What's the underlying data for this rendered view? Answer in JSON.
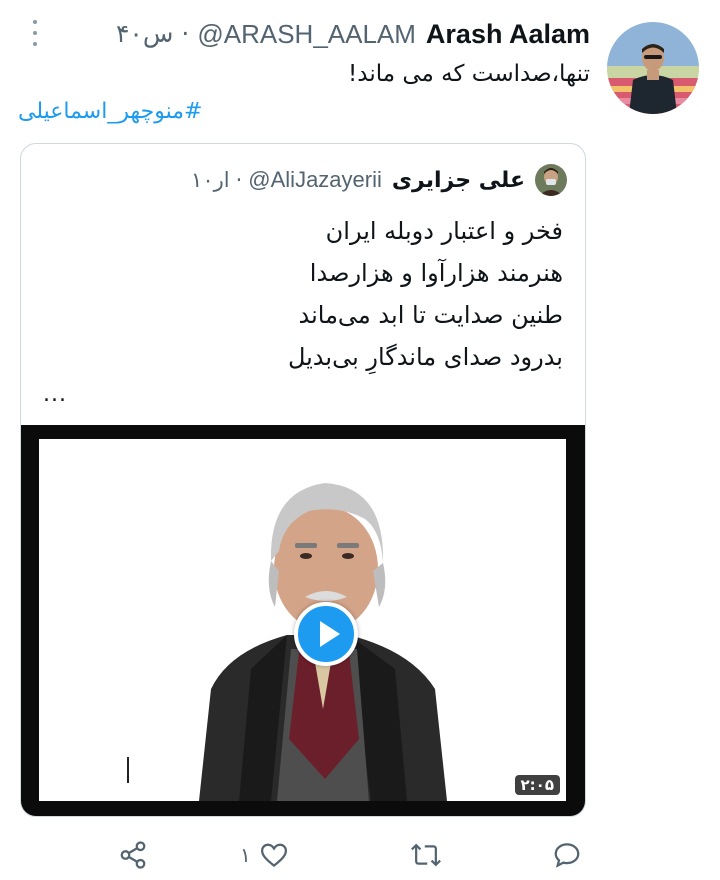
{
  "tweet": {
    "display_name": "Arash Aalam",
    "handle": "@ARASH_AALAM",
    "separator": "·",
    "time": "۴۰س",
    "text": "تنها،صداست که می ماند!",
    "hashtag": "#منوچهر_اسماعیلی"
  },
  "quoted": {
    "display_name": "علی جزایری",
    "handle": "@AliJazayerii",
    "separator": "·",
    "time": "۱۰ار",
    "lines": [
      "فخر و اعتبار دوبله ایران",
      "هنرمند هزارآوا و هزارصدا",
      "طنین صدایت تا ابد می‌ماند",
      "بدرود صدای ماندگارِ بی‌بدیل"
    ],
    "ellipsis": "...",
    "video_duration": "۲:۰۵"
  },
  "actions": {
    "like_count": "۱"
  },
  "icons": {
    "more": "more-vertical-icon",
    "share": "share-icon",
    "like": "heart-icon",
    "retweet": "retweet-icon",
    "reply": "reply-icon",
    "play": "play-icon"
  },
  "colors": {
    "link": "#1d9bf0",
    "muted": "#536471",
    "text": "#0f1419",
    "border": "#cfd9de"
  }
}
